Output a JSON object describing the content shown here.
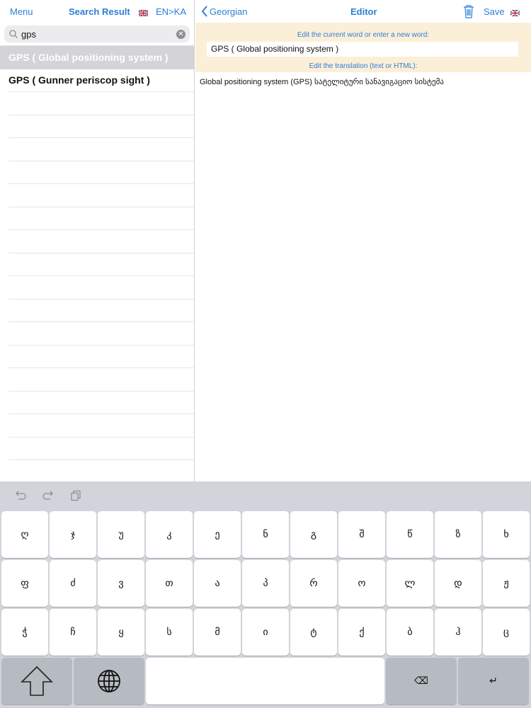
{
  "left_bar": {
    "menu": "Menu",
    "title": "Search Result",
    "lang": "EN>KA"
  },
  "search": {
    "value": "gps"
  },
  "results": [
    {
      "label": "GPS ( Global positioning system )",
      "selected": true
    },
    {
      "label": "GPS ( Gunner periscop sight )",
      "selected": false
    },
    {
      "label": "",
      "selected": false
    },
    {
      "label": "",
      "selected": false
    },
    {
      "label": "",
      "selected": false
    },
    {
      "label": "",
      "selected": false
    },
    {
      "label": "",
      "selected": false
    },
    {
      "label": "",
      "selected": false
    },
    {
      "label": "",
      "selected": false
    },
    {
      "label": "",
      "selected": false
    },
    {
      "label": "",
      "selected": false
    },
    {
      "label": "",
      "selected": false
    },
    {
      "label": "",
      "selected": false
    },
    {
      "label": "",
      "selected": false
    },
    {
      "label": "",
      "selected": false
    },
    {
      "label": "",
      "selected": false
    },
    {
      "label": "",
      "selected": false
    },
    {
      "label": "",
      "selected": false
    },
    {
      "label": "",
      "selected": false
    }
  ],
  "right_bar": {
    "back": "Georgian",
    "title": "Editor",
    "save": "Save"
  },
  "editor": {
    "word_label": "Edit the current word or enter a new word:",
    "word_value": "GPS ( Global positioning system )",
    "translation_label": "Edit the translation (text or HTML):",
    "translation_value": "Global positioning system (GPS)  სატელიტური სანავიგაციო სისტემა"
  },
  "keyboard": {
    "row1": [
      "ღ",
      "ჯ",
      "უ",
      "კ",
      "ე",
      "ნ",
      "გ",
      "შ",
      "წ",
      "ზ",
      "ხ"
    ],
    "row2": [
      "ფ",
      "ძ",
      "ვ",
      "თ",
      "ა",
      "პ",
      "რ",
      "ო",
      "ლ",
      "დ",
      "ჟ"
    ],
    "row3": [
      "ჭ",
      "ჩ",
      "ყ",
      "ს",
      "მ",
      "ი",
      "ტ",
      "ქ",
      "ბ",
      "ჰ",
      "ც"
    ],
    "delete": "⌫",
    "return": "↵"
  },
  "colors": {
    "accent": "#2b7fd6",
    "edit_bg": "#fcefd8",
    "selected_row": "#d3d3d8",
    "keyboard_bg": "#d1d4da"
  }
}
